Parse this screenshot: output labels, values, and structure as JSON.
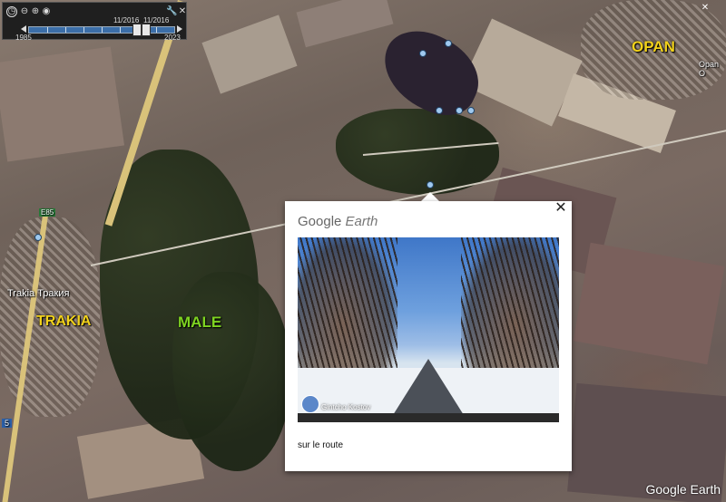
{
  "time_slider": {
    "start_date": "11/2016",
    "end_date": "11/2016",
    "year_start": "1985",
    "year_end": "2023",
    "icons": [
      "clock-icon",
      "zoom-out-icon",
      "zoom-in-icon",
      "eye-icon",
      "wrench-icon",
      "close-icon"
    ]
  },
  "map_labels": {
    "opan": "OPAN",
    "trakia": "TRAKIA",
    "male": "MALE",
    "trakia_small": "Trakia Тракия",
    "opan_small": "Opan О",
    "road_e85": "E85",
    "road_5": "5"
  },
  "popup": {
    "brand_google": "Google",
    "brand_earth": "Earth",
    "photo_credit": "Gintcho Kostov",
    "caption": "sur le route",
    "close_glyph": "✕"
  },
  "watermark": "Google Earth",
  "colors": {
    "opan_label": "#f2d21b",
    "trakia_label": "#f2d21b",
    "male_label": "#7ed321"
  }
}
